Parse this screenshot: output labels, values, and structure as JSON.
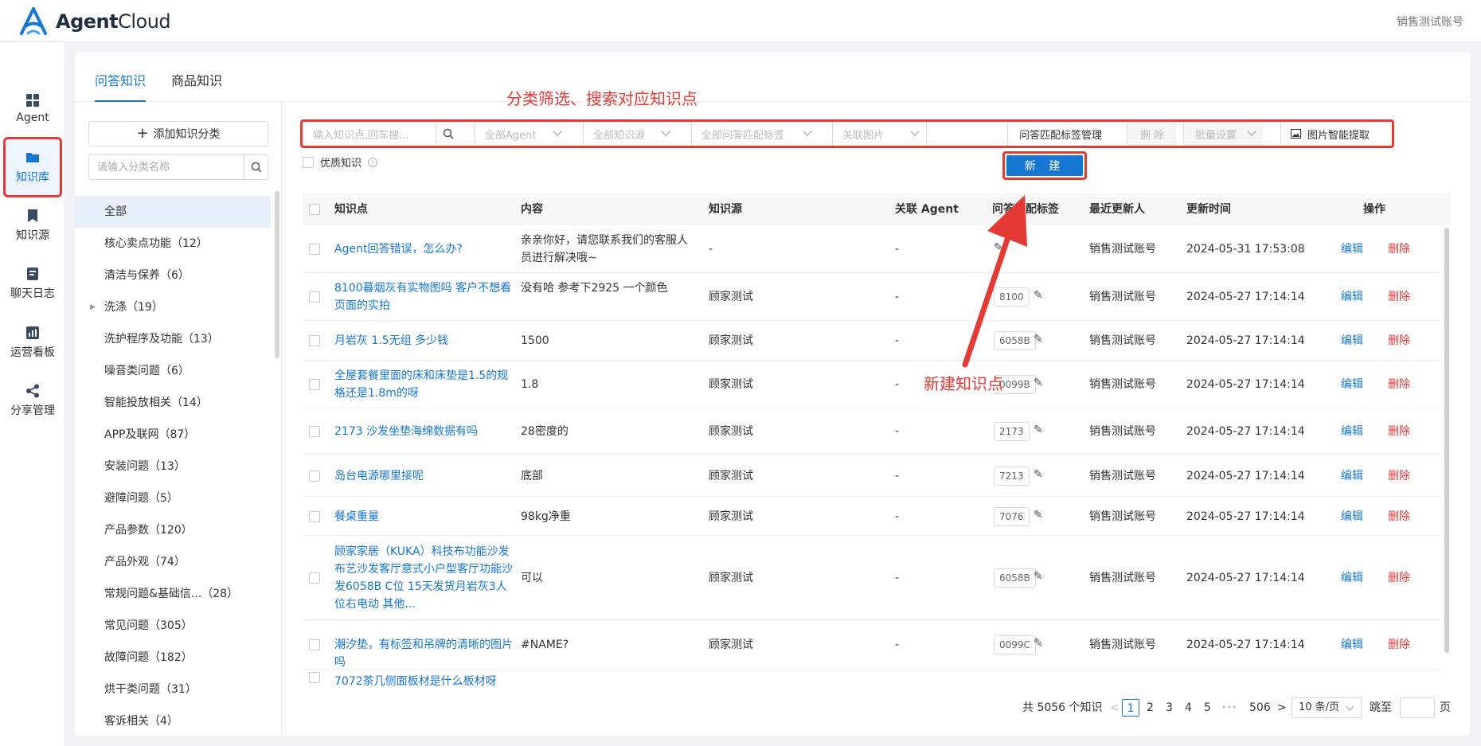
{
  "app": {
    "brand_bold": "Agent",
    "brand_light": "Cloud",
    "account": "销售测试账号"
  },
  "nav": [
    {
      "label": "Agent",
      "icon": "grid-icon"
    },
    {
      "label": "知识库",
      "icon": "folder-icon"
    },
    {
      "label": "知识源",
      "icon": "book-icon"
    },
    {
      "label": "聊天日志",
      "icon": "chat-log-icon"
    },
    {
      "label": "运营看板",
      "icon": "chart-icon"
    },
    {
      "label": "分享管理",
      "icon": "share-icon"
    }
  ],
  "tabs": [
    "问答知识",
    "商品知识"
  ],
  "annotations": {
    "filter": "分类筛选、搜索对应知识点",
    "new": "新建知识点",
    "color": "#e53935"
  },
  "sidebar": {
    "add_category": "添加知识分类",
    "search_placeholder": "请输入分类名称",
    "categories": [
      "全部",
      "核心卖点功能（12）",
      "清洁与保养（6）",
      "洗涤（19）",
      "洗护程序及功能（13）",
      "噪音类问题（6）",
      "智能投放相关（14）",
      "APP及联网（87）",
      "安装问题（13）",
      "避障问题（5）",
      "产品参数（120）",
      "产品外观（74）",
      "常规问题&基础信...（28）",
      "常见问题（305）",
      "故障问题（182）",
      "烘干类问题（31）",
      "客诉相关（4）"
    ]
  },
  "filters": {
    "search_placeholder": "输入知识点,回车搜...",
    "agent": "全部Agent",
    "source": "全部知识源",
    "tags": "全部问答匹配标签",
    "image": "关联图片",
    "tag_manage": "问答匹配标签管理",
    "delete": "删 除",
    "batch": "批量设置",
    "image_extract": "图片智能提取",
    "quality": "优质知识",
    "new": "新 建"
  },
  "table": {
    "headers": [
      "知识点",
      "内容",
      "知识源",
      "关联 Agent",
      "问答匹配标签",
      "最近更新人",
      "更新时间",
      "操作"
    ],
    "edit": "编辑",
    "delete": "删除",
    "rows": [
      {
        "q": "Agent回答错误，怎么办?",
        "c": "亲亲你好，请您联系我们的客服人员进行解决哦~",
        "src": "-",
        "agent": "-",
        "tag": "",
        "user": "销售测试账号",
        "time": "2024-05-31 17:53:08"
      },
      {
        "q": "8100暮烟灰有实物图吗 客户不想看页面的实拍",
        "c": "没有哈 参考下2925 一个颜色",
        "src": "顾家测试",
        "agent": "-",
        "tag": "8100",
        "user": "销售测试账号",
        "time": "2024-05-27 17:14:14"
      },
      {
        "q": "月岩灰 1.5无组 多少钱",
        "c": "1500",
        "src": "顾家测试",
        "agent": "-",
        "tag": "6058B",
        "user": "销售测试账号",
        "time": "2024-05-27 17:14:14"
      },
      {
        "q": "全屋套餐里面的床和床垫是1.5的规格还是1.8m的呀",
        "c": "1.8",
        "src": "顾家测试",
        "agent": "-",
        "tag": "0099B",
        "user": "销售测试账号",
        "time": "2024-05-27 17:14:14"
      },
      {
        "q": "2173 沙发坐垫海绵数据有吗",
        "c": "28密度的",
        "src": "顾家测试",
        "agent": "-",
        "tag": "2173",
        "user": "销售测试账号",
        "time": "2024-05-27 17:14:14"
      },
      {
        "q": "岛台电源哪里接呢",
        "c": "底部",
        "src": "顾家测试",
        "agent": "-",
        "tag": "7213",
        "user": "销售测试账号",
        "time": "2024-05-27 17:14:14"
      },
      {
        "q": "餐桌重量",
        "c": "98kg净重",
        "src": "顾家测试",
        "agent": "-",
        "tag": "7076",
        "user": "销售测试账号",
        "time": "2024-05-27 17:14:14"
      },
      {
        "q": "顾家家居（KUKA）科技布功能沙发布艺沙发客厅意式小户型客厅功能沙发6058B C位 15天发货月岩灰3人位右电动 其他...",
        "c": "可以",
        "src": "顾家测试",
        "agent": "-",
        "tag": "6058B",
        "user": "销售测试账号",
        "time": "2024-05-27 17:14:14"
      },
      {
        "q": "潮汐垫，有标签和吊牌的清晰的图片吗",
        "c": "#NAME?",
        "src": "顾家测试",
        "agent": "-",
        "tag": "0099C",
        "user": "销售测试账号",
        "time": "2024-05-27 17:14:14"
      },
      {
        "q": "7072茶几侧面板材是什么板材呀",
        "c": "",
        "src": "",
        "agent": "",
        "tag": "",
        "user": "",
        "time": ""
      }
    ]
  },
  "pagination": {
    "total": "共 5056 个知识",
    "prev": "<",
    "pages": [
      "1",
      "2",
      "3",
      "4",
      "5",
      "•••",
      "506"
    ],
    "next": ">",
    "page_size": "10 条/页",
    "jump": "跳至",
    "page_unit": "页"
  }
}
